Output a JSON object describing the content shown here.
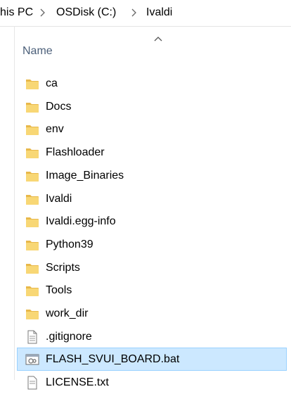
{
  "breadcrumb": {
    "items": [
      {
        "label": "his PC"
      },
      {
        "label": "OSDisk (C:)"
      },
      {
        "label": "Ivaldi"
      }
    ]
  },
  "columns": {
    "name": "Name"
  },
  "files": [
    {
      "name": "ca",
      "type": "folder"
    },
    {
      "name": "Docs",
      "type": "folder"
    },
    {
      "name": "env",
      "type": "folder"
    },
    {
      "name": "Flashloader",
      "type": "folder"
    },
    {
      "name": "Image_Binaries",
      "type": "folder"
    },
    {
      "name": "Ivaldi",
      "type": "folder"
    },
    {
      "name": "Ivaldi.egg-info",
      "type": "folder"
    },
    {
      "name": "Python39",
      "type": "folder"
    },
    {
      "name": "Scripts",
      "type": "folder"
    },
    {
      "name": "Tools",
      "type": "folder"
    },
    {
      "name": "work_dir",
      "type": "folder"
    },
    {
      "name": ".gitignore",
      "type": "file"
    },
    {
      "name": "FLASH_SVUI_BOARD.bat",
      "type": "batch",
      "selected": true
    },
    {
      "name": "LICENSE.txt",
      "type": "text"
    }
  ],
  "colors": {
    "folder": "#f8d775",
    "folderDark": "#e8b84a",
    "selection": "#cce8ff",
    "selectionBorder": "#99d1ff",
    "headerText": "#4c607a"
  },
  "icons": {
    "folder": "folder-icon",
    "file": "document-icon",
    "batch": "batch-file-icon",
    "text": "text-file-icon"
  }
}
